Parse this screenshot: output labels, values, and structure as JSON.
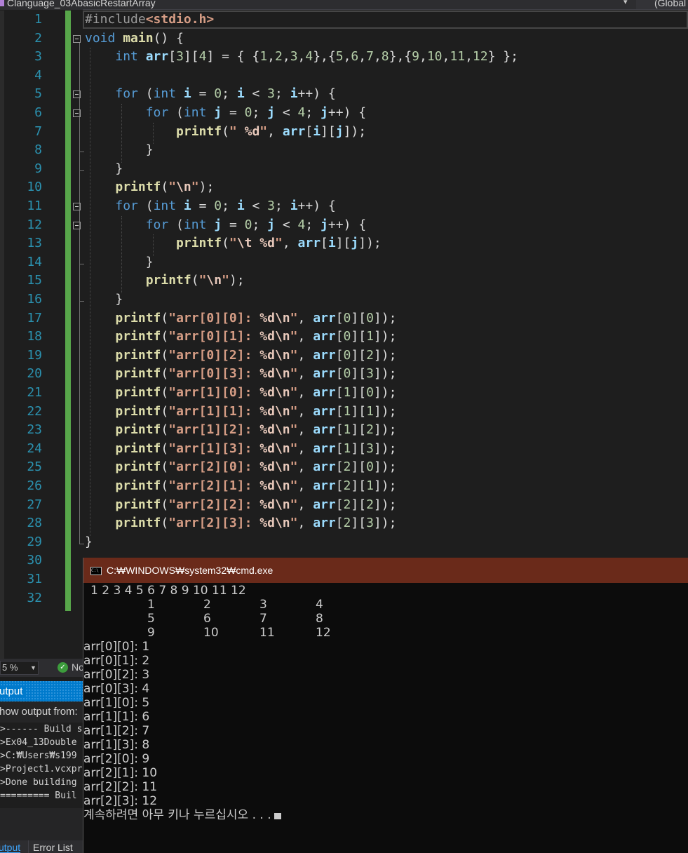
{
  "nav": {
    "file_dropdown": "Clanguage_03AbasicRestartArray",
    "scope_dropdown": "(Global"
  },
  "editor": {
    "line_numbers": [
      "1",
      "2",
      "3",
      "4",
      "5",
      "6",
      "7",
      "8",
      "9",
      "10",
      "11",
      "12",
      "13",
      "14",
      "15",
      "16",
      "17",
      "18",
      "19",
      "20",
      "21",
      "22",
      "23",
      "24",
      "25",
      "26",
      "27",
      "28",
      "29",
      "30",
      "31",
      "32"
    ],
    "lines": [
      "#include<stdio.h>",
      "void main() {",
      "    int arr[3][4] = { {1,2,3,4},{5,6,7,8},{9,10,11,12} };",
      "",
      "    for (int i = 0; i < 3; i++) {",
      "        for (int j = 0; j < 4; j++) {",
      "            printf(\" %d\", arr[i][j]);",
      "        }",
      "    }",
      "    printf(\"\\n\");",
      "    for (int i = 0; i < 3; i++) {",
      "        for (int j = 0; j < 4; j++) {",
      "            printf(\"\\t %d\", arr[i][j]);",
      "        }",
      "        printf(\"\\n\");",
      "    }",
      "    printf(\"arr[0][0]: %d\\n\", arr[0][0]);",
      "    printf(\"arr[0][1]: %d\\n\", arr[0][1]);",
      "    printf(\"arr[0][2]: %d\\n\", arr[0][2]);",
      "    printf(\"arr[0][3]: %d\\n\", arr[0][3]);",
      "    printf(\"arr[1][0]: %d\\n\", arr[1][0]);",
      "    printf(\"arr[1][1]: %d\\n\", arr[1][1]);",
      "    printf(\"arr[1][2]: %d\\n\", arr[1][2]);",
      "    printf(\"arr[1][3]: %d\\n\", arr[1][3]);",
      "    printf(\"arr[2][0]: %d\\n\", arr[2][0]);",
      "    printf(\"arr[2][1]: %d\\n\", arr[2][1]);",
      "    printf(\"arr[2][2]: %d\\n\", arr[2][2]);",
      "    printf(\"arr[2][3]: %d\\n\", arr[2][3]);",
      "}",
      "",
      "",
      ""
    ]
  },
  "status": {
    "zoom": "5 %",
    "issues_text": "No"
  },
  "output_panel": {
    "title": "utput",
    "show_from_label": "how output from:",
    "lines": [
      ">------ Build s",
      ">Ex04_13Double",
      ">C:₩Users₩s199",
      ">Project1.vcxpr",
      ">Done building",
      "========= Buil"
    ],
    "tabs": [
      "utput",
      "Error List"
    ]
  },
  "console": {
    "title": "C:₩WINDOWS₩system32₩cmd.exe",
    "line1": "1 2 3 4 5 6 7 8 9 10 11 12",
    "tab_rows": [
      [
        "1",
        "2",
        "3",
        "4"
      ],
      [
        "5",
        "6",
        "7",
        "8"
      ],
      [
        "9",
        "10",
        "11",
        "12"
      ]
    ],
    "element_lines": [
      "arr[0][0]: 1",
      "arr[0][1]: 2",
      "arr[0][2]: 3",
      "arr[0][3]: 4",
      "arr[1][0]: 5",
      "arr[1][1]: 6",
      "arr[1][2]: 7",
      "arr[1][3]: 8",
      "arr[2][0]: 9",
      "arr[2][1]: 10",
      "arr[2][2]: 11",
      "arr[2][3]: 12"
    ],
    "prompt": "계속하려면 아무 키나 누르십시오 . . ."
  },
  "colors": {
    "keyword": "#569cd6",
    "function": "#dcdcaa",
    "string": "#d69d85",
    "number": "#b5cea8",
    "variable": "#9cdcfe",
    "line_number": "#2b91af",
    "change_bar": "#57a64a",
    "console_title_bg": "#6a2a1a",
    "panel_accent": "#007acc"
  }
}
